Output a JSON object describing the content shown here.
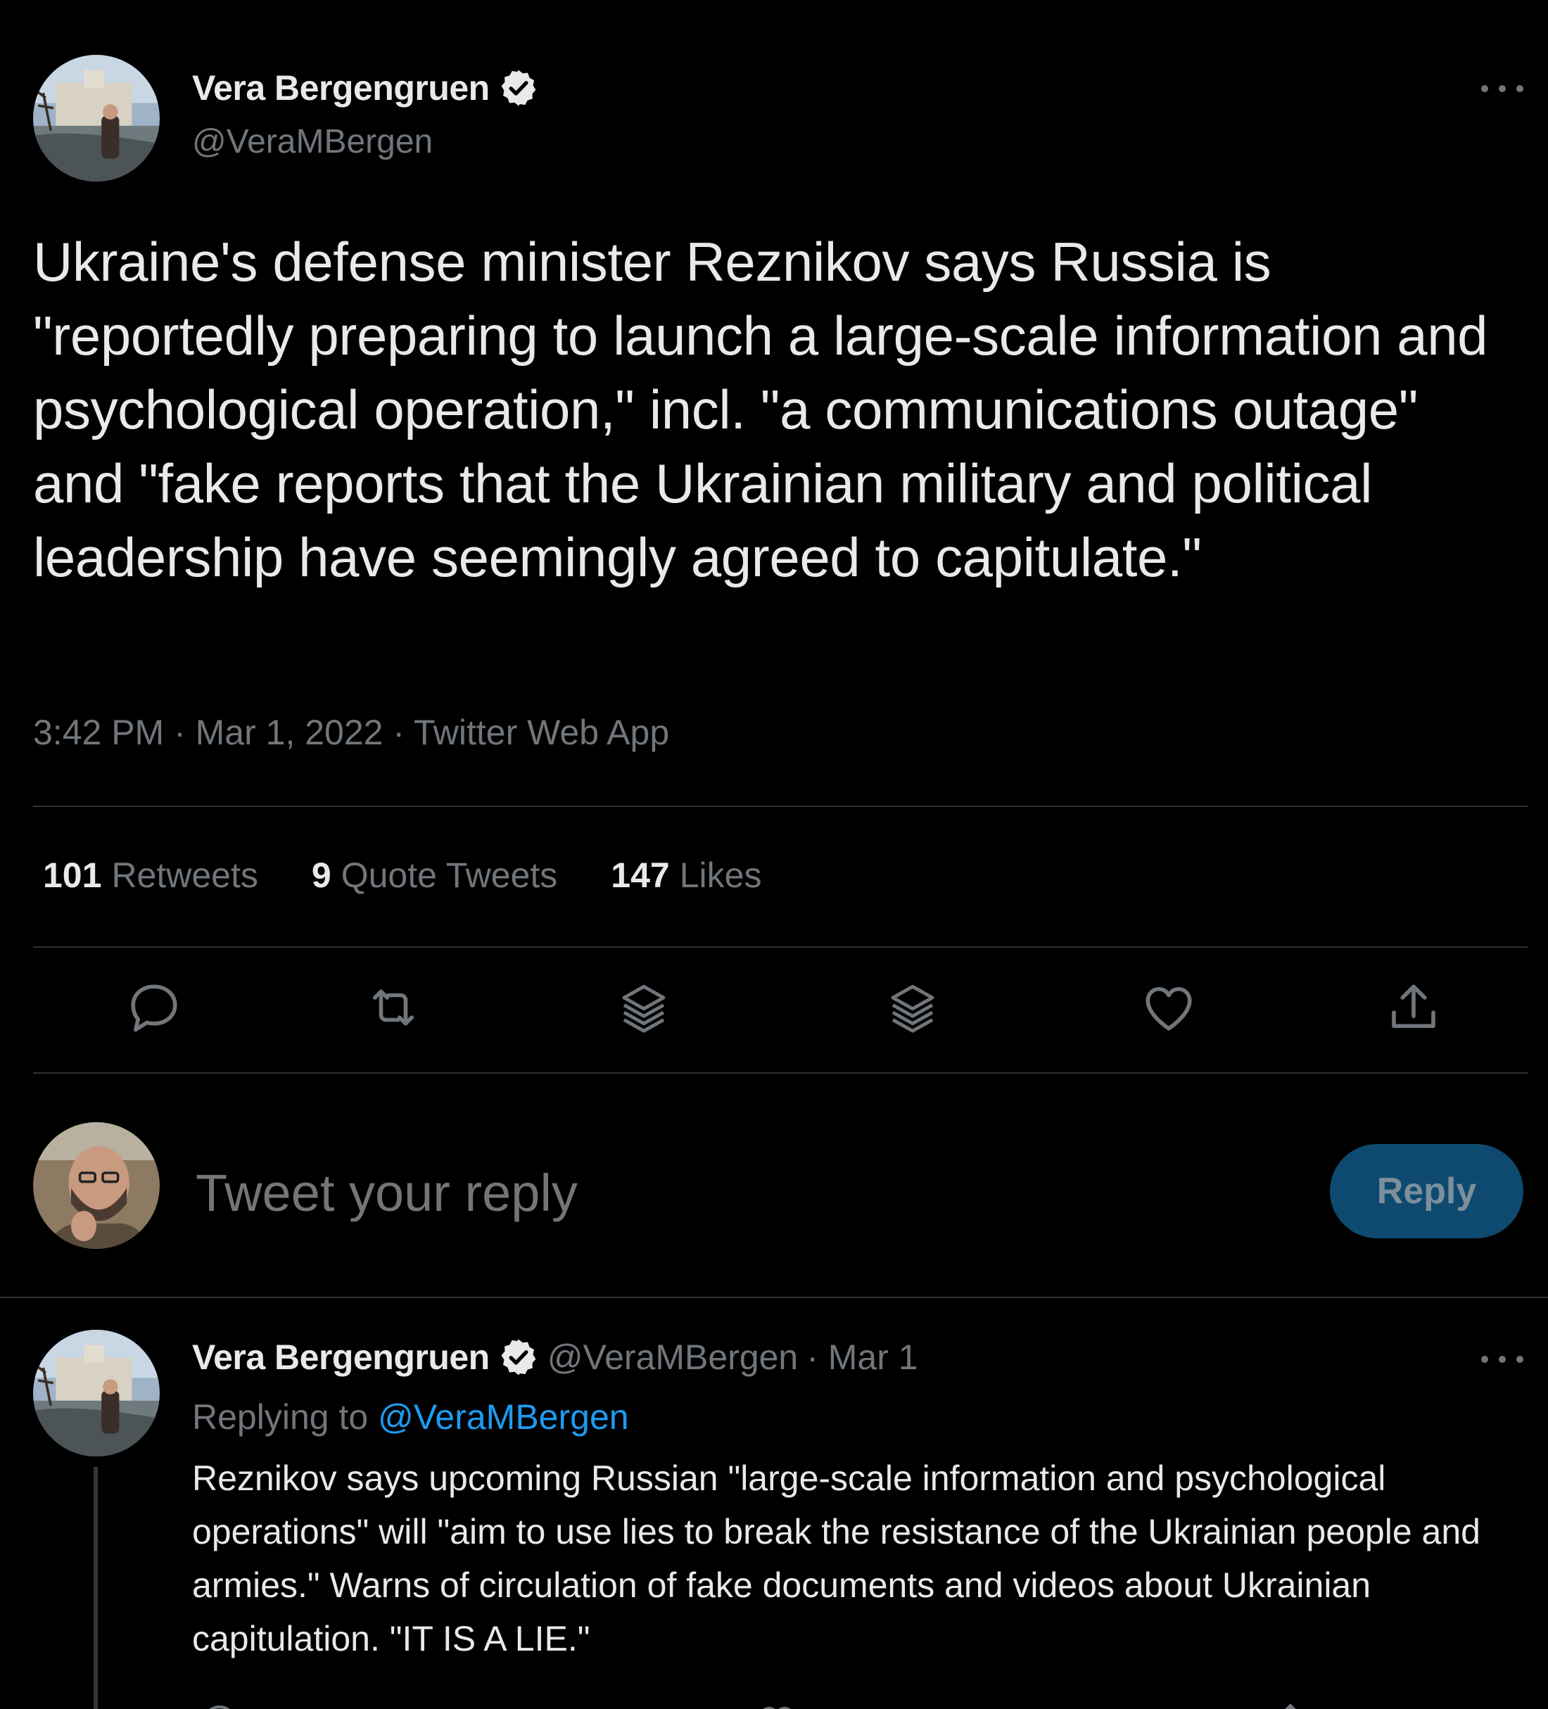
{
  "main_tweet": {
    "author_name": "Vera Bergengruen",
    "author_handle": "@VeraMBergen",
    "text": "Ukraine's defense minister Reznikov says Russia is \"reportedly preparing to launch a large-scale information and psychological operation,\" incl. \"a communications outage\" and \"fake reports that the Ukrainian military and political leadership have seemingly agreed to capitulate.\"",
    "meta": "3:42 PM · Mar 1, 2022 · Twitter Web App",
    "stats": [
      {
        "count": "101",
        "label": "Retweets"
      },
      {
        "count": "9",
        "label": "Quote Tweets"
      },
      {
        "count": "147",
        "label": "Likes"
      }
    ]
  },
  "composer": {
    "placeholder": "Tweet your reply",
    "button_label": "Reply"
  },
  "thread_tweet": {
    "author_name": "Vera Bergengruen",
    "author_handle": "@VeraMBergen",
    "date": "· Mar 1",
    "replying_prefix": "Replying to",
    "replying_handle": "@VeraMBergen",
    "text": "Reznikov says upcoming Russian \"large-scale information and psychological operations\" will \"aim to use lies to break the resistance of the Ukrainian people and armies.\" Warns of circulation of fake documents and videos about Ukrainian capitulation. \"IT IS A LIE.\""
  },
  "icons": {
    "reply": "reply-icon",
    "retweet": "retweet-icon",
    "stack": "layers-icon",
    "like": "heart-icon",
    "share": "share-icon",
    "more": "more-icon",
    "verified": "verified-icon"
  },
  "colors": {
    "background": "#000000",
    "text": "#e7e9ea",
    "muted": "#71767b",
    "accent": "#1d9bf0",
    "reply_button_disabled": "#0e4a6f"
  }
}
